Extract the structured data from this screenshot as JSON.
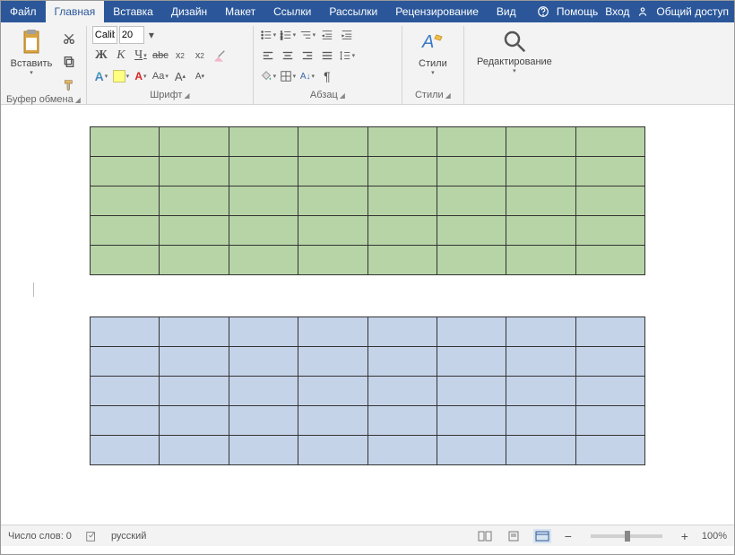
{
  "menubar": {
    "items": [
      "Файл",
      "Главная",
      "Вставка",
      "Дизайн",
      "Макет",
      "Ссылки",
      "Рассылки",
      "Рецензирование",
      "Вид"
    ],
    "active": 1,
    "help": "Помощь",
    "login": "Вход",
    "share": "Общий доступ"
  },
  "ribbon": {
    "clipboard": {
      "paste": "Вставить",
      "label": "Буфер обмена"
    },
    "font": {
      "name": "Calibri Light (Заголовки)",
      "size": "20",
      "label": "Шрифт"
    },
    "paragraph": {
      "label": "Абзац"
    },
    "styles": {
      "btn": "Стили",
      "label": "Стили"
    },
    "editing": {
      "btn": "Редактирование"
    }
  },
  "document": {
    "tables": [
      {
        "rows": 5,
        "cols": 8,
        "fill": "green"
      },
      {
        "rows": 5,
        "cols": 8,
        "fill": "blue"
      }
    ]
  },
  "status": {
    "words": "Число слов: 0",
    "lang": "русский",
    "zoom": "100%"
  }
}
